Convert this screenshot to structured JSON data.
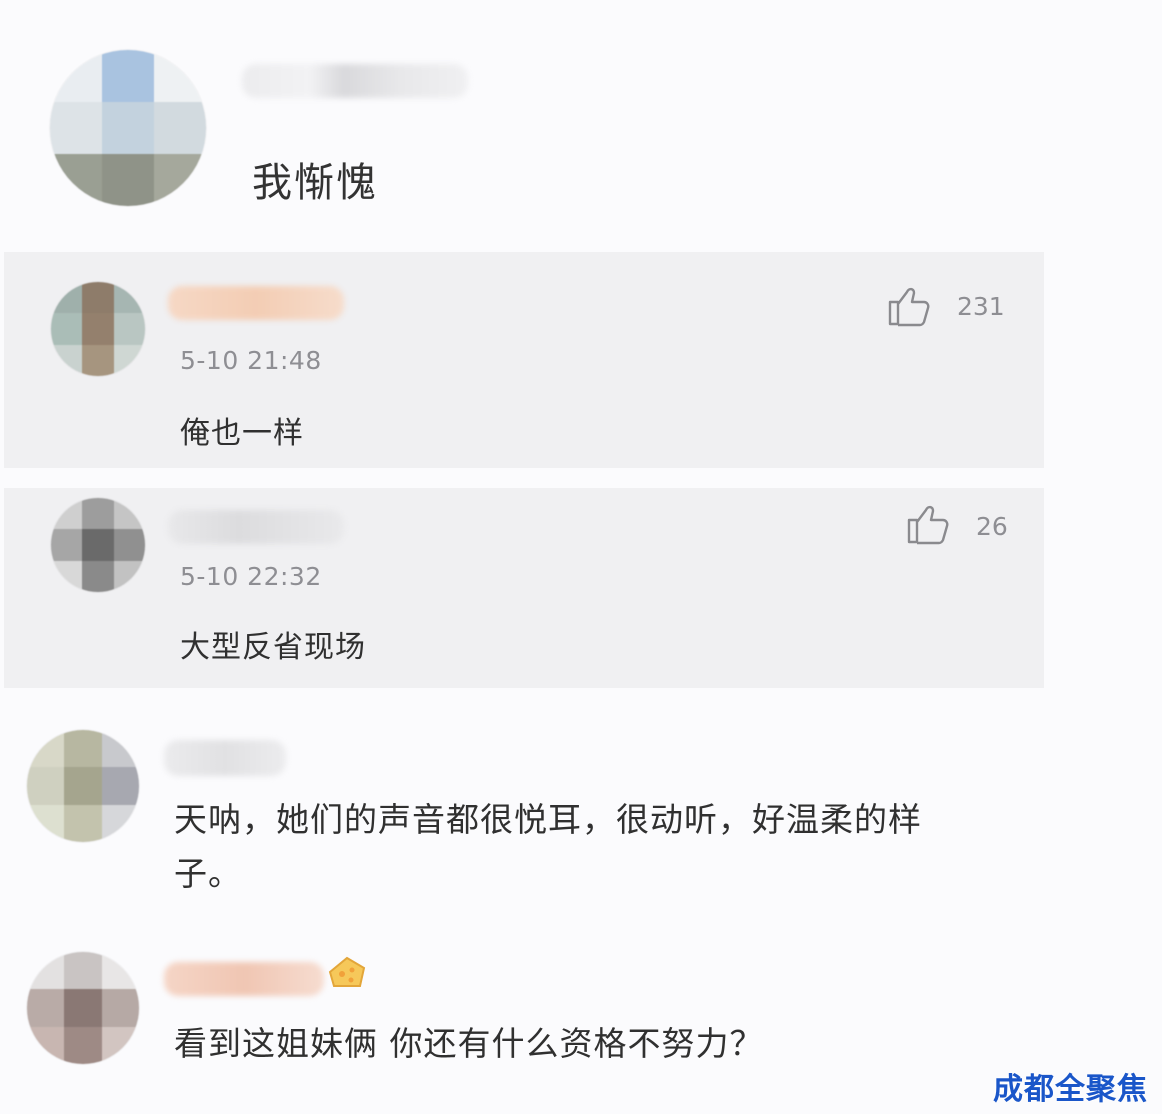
{
  "main_comment": {
    "text": "我惭愧"
  },
  "replies": [
    {
      "time": "5-10 21:48",
      "text": "俺也一样",
      "likes": "231"
    },
    {
      "time": "5-10 22:32",
      "text": "大型反省现场",
      "likes": "26"
    }
  ],
  "comments": [
    {
      "text_line1": "天呐，她们的声音都很悦耳，很动听，好温柔的样",
      "text_line2": "子。"
    },
    {
      "text": "看到这姐妹俩 你还有什么资格不努力？"
    }
  ],
  "watermark": "成都全聚焦",
  "icons": {
    "like": "thumbs-up-icon"
  },
  "colors": {
    "reply_bg": "#f0f0f2",
    "page_bg": "#fbfbfd",
    "meta_gray": "#8e8e93",
    "watermark": "#1a56c9"
  }
}
